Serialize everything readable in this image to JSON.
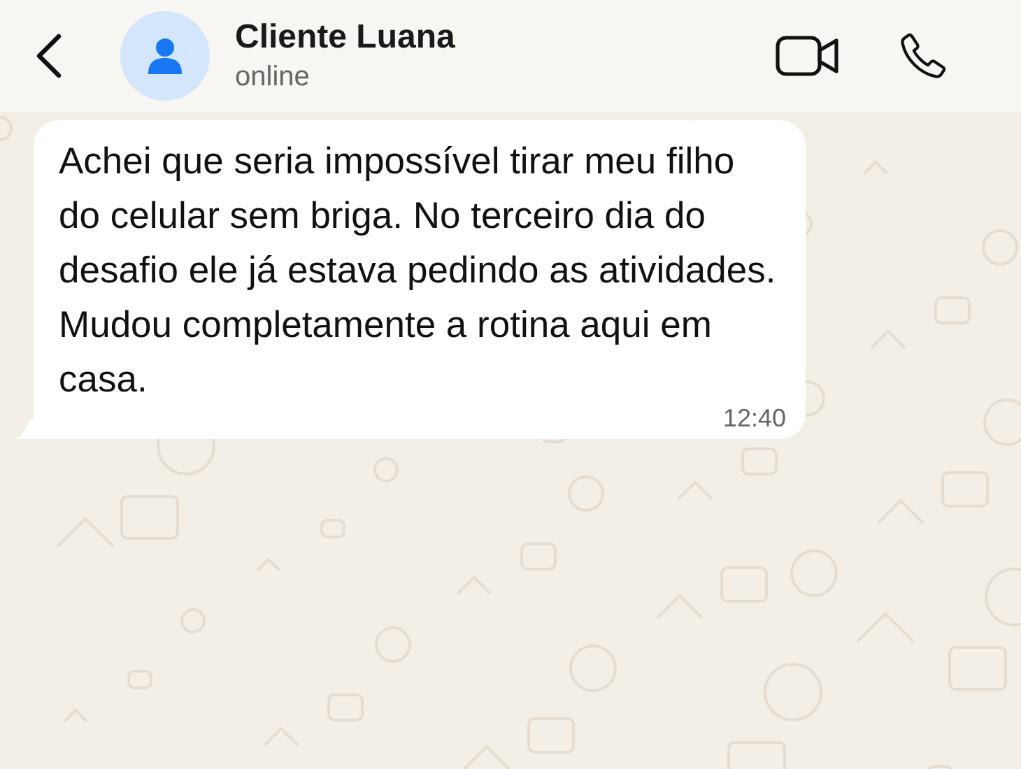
{
  "header": {
    "contact_name": "Cliente Luana",
    "status": "online"
  },
  "messages": [
    {
      "kind": "incoming",
      "text": "Achei que seria impossível tirar meu filho do celular sem briga. No terceiro dia do desafio ele já estava pedindo as atividades. Mudou completamente a rotina aqui em casa.",
      "time": "12:40"
    }
  ]
}
